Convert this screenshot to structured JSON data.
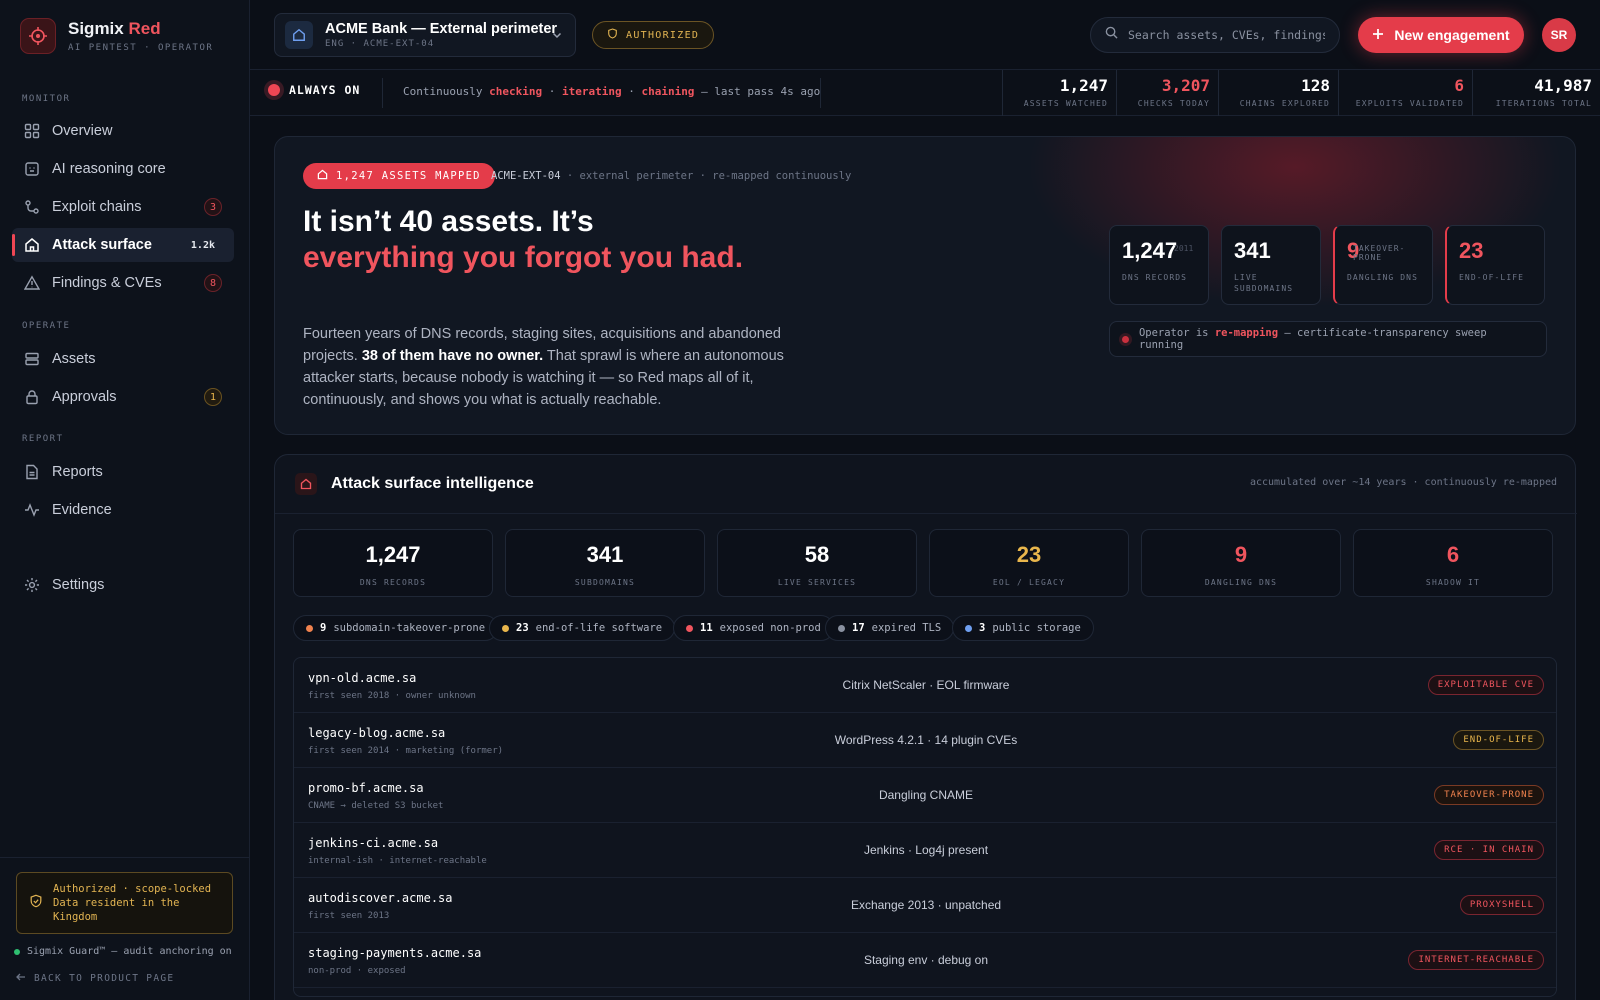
{
  "brand": {
    "name": "Sigmix",
    "accent": "Red",
    "subtitle": "AI PENTEST · OPERATOR"
  },
  "sidebar": {
    "sections": {
      "monitor": "MONITOR",
      "operate": "OPERATE",
      "report": "REPORT"
    },
    "items": [
      {
        "label": "Overview",
        "icon": "grid-icon"
      },
      {
        "label": "AI reasoning core",
        "icon": "cpu-icon"
      },
      {
        "label": "Exploit chains",
        "icon": "chain-icon",
        "badge": "3"
      },
      {
        "label": "Attack surface",
        "icon": "home-icon",
        "badge": "1.2k",
        "active": true
      },
      {
        "label": "Findings & CVEs",
        "icon": "warning-icon",
        "badge": "8"
      },
      {
        "label": "Assets",
        "icon": "server-icon"
      },
      {
        "label": "Approvals",
        "icon": "lock-icon",
        "badge": "1"
      },
      {
        "label": "Reports",
        "icon": "document-icon"
      },
      {
        "label": "Evidence",
        "icon": "activity-icon"
      },
      {
        "label": "Settings",
        "icon": "gear-icon"
      }
    ],
    "auth_box": "Authorized · scope-locked Data resident in the Kingdom",
    "guard": "Sigmix Guard™ — audit anchoring on",
    "back": "BACK TO PRODUCT PAGE"
  },
  "topbar": {
    "engagement_title": "ACME Bank — External perimeter",
    "engagement_sub": "ENG · ACME-EXT-04",
    "authorized": "AUTHORIZED",
    "search_placeholder": "Search assets, CVEs, findings…",
    "new_button": "New engagement",
    "avatar": "SR"
  },
  "strip": {
    "always_on": "ALWAYS ON",
    "prefix": "Continuously",
    "w1": "checking",
    "w2": "iterating",
    "w3": "chaining",
    "suffix": "— last pass 4s ago",
    "sep": "·",
    "kpis": [
      {
        "value": "1,247",
        "label": "ASSETS WATCHED"
      },
      {
        "value": "3,207",
        "label": "CHECKS TODAY",
        "red": true
      },
      {
        "value": "128",
        "label": "CHAINS EXPLORED"
      },
      {
        "value": "6",
        "label": "EXPLOITS VALIDATED",
        "red": true
      },
      {
        "value": "41,987",
        "label": "ITERATIONS TOTAL"
      }
    ]
  },
  "hero": {
    "pill": "1,247 ASSETS MAPPED",
    "meta_id": "ACME-EXT-04",
    "meta_rest": "· external perimeter · re-mapped continuously",
    "title_plain": "It isn’t 40 assets. It’s",
    "title_red": "everything you forgot you had.",
    "desc_1": "Fourteen years of DNS records, staging sites, acquisitions and abandoned projects.",
    "desc_bold": "38 of them have no owner.",
    "desc_2": "That sprawl is where an autonomous attacker starts, because nobody is watching it — so Red maps all of it, continuously, and shows you what is actually reachable.",
    "stats": [
      {
        "value": "1,247",
        "label": "DNS RECORDS",
        "faint": "2011"
      },
      {
        "value": "341",
        "label": "LIVE SUBDOMAINS"
      },
      {
        "value": "9",
        "label": "DANGLING DNS",
        "faint": "TAKEOVER-PRONE",
        "red": true
      },
      {
        "value": "23",
        "label": "END-OF-LIFE",
        "red": true
      }
    ],
    "operator_pre": "Operator is",
    "operator_bold": "re-mapping",
    "operator_post": "— certificate-transparency sweep running"
  },
  "intel": {
    "title": "Attack surface intelligence",
    "note": "accumulated over ~14 years · continuously re-mapped",
    "cards": [
      {
        "value": "1,247",
        "label": "DNS RECORDS"
      },
      {
        "value": "341",
        "label": "SUBDOMAINS"
      },
      {
        "value": "58",
        "label": "LIVE SERVICES"
      },
      {
        "value": "23",
        "label": "EOL / LEGACY",
        "tone": "amber"
      },
      {
        "value": "9",
        "label": "DANGLING DNS",
        "tone": "red"
      },
      {
        "value": "6",
        "label": "SHADOW IT",
        "tone": "red"
      }
    ],
    "chips": [
      {
        "count": "9",
        "label": "subdomain-takeover-prone",
        "color": "#f0824e"
      },
      {
        "count": "23",
        "label": "end-of-life software",
        "color": "#e9b64c"
      },
      {
        "count": "11",
        "label": "exposed non-prod",
        "color": "#f0555e"
      },
      {
        "count": "17",
        "label": "expired TLS",
        "color": "#8a91a0"
      },
      {
        "count": "3",
        "label": "public storage",
        "color": "#6f9ff0"
      }
    ],
    "rows": [
      {
        "host": "vpn-old.acme.sa",
        "sub": "first seen 2018 · owner unknown",
        "desc": "Citrix NetScaler · EOL firmware",
        "tag": "EXPLOITABLE CVE",
        "tone": "red"
      },
      {
        "host": "legacy-blog.acme.sa",
        "sub": "first seen 2014 · marketing (former)",
        "desc": "WordPress 4.2.1 · 14 plugin CVEs",
        "tag": "END-OF-LIFE",
        "tone": "amber"
      },
      {
        "host": "promo-bf.acme.sa",
        "sub": "CNAME → deleted S3 bucket",
        "desc": "Dangling CNAME",
        "tag": "TAKEOVER-PRONE",
        "tone": "orange"
      },
      {
        "host": "jenkins-ci.acme.sa",
        "sub": "internal-ish · internet-reachable",
        "desc": "Jenkins · Log4j present",
        "tag": "RCE · IN CHAIN",
        "tone": "red"
      },
      {
        "host": "autodiscover.acme.sa",
        "sub": "first seen 2013",
        "desc": "Exchange 2013 · unpatched",
        "tag": "PROXYSHELL",
        "tone": "red"
      },
      {
        "host": "staging-payments.acme.sa",
        "sub": "non-prod · exposed",
        "desc": "Staging env · debug on",
        "tag": "INTERNET-REACHABLE",
        "tone": "red"
      }
    ]
  }
}
